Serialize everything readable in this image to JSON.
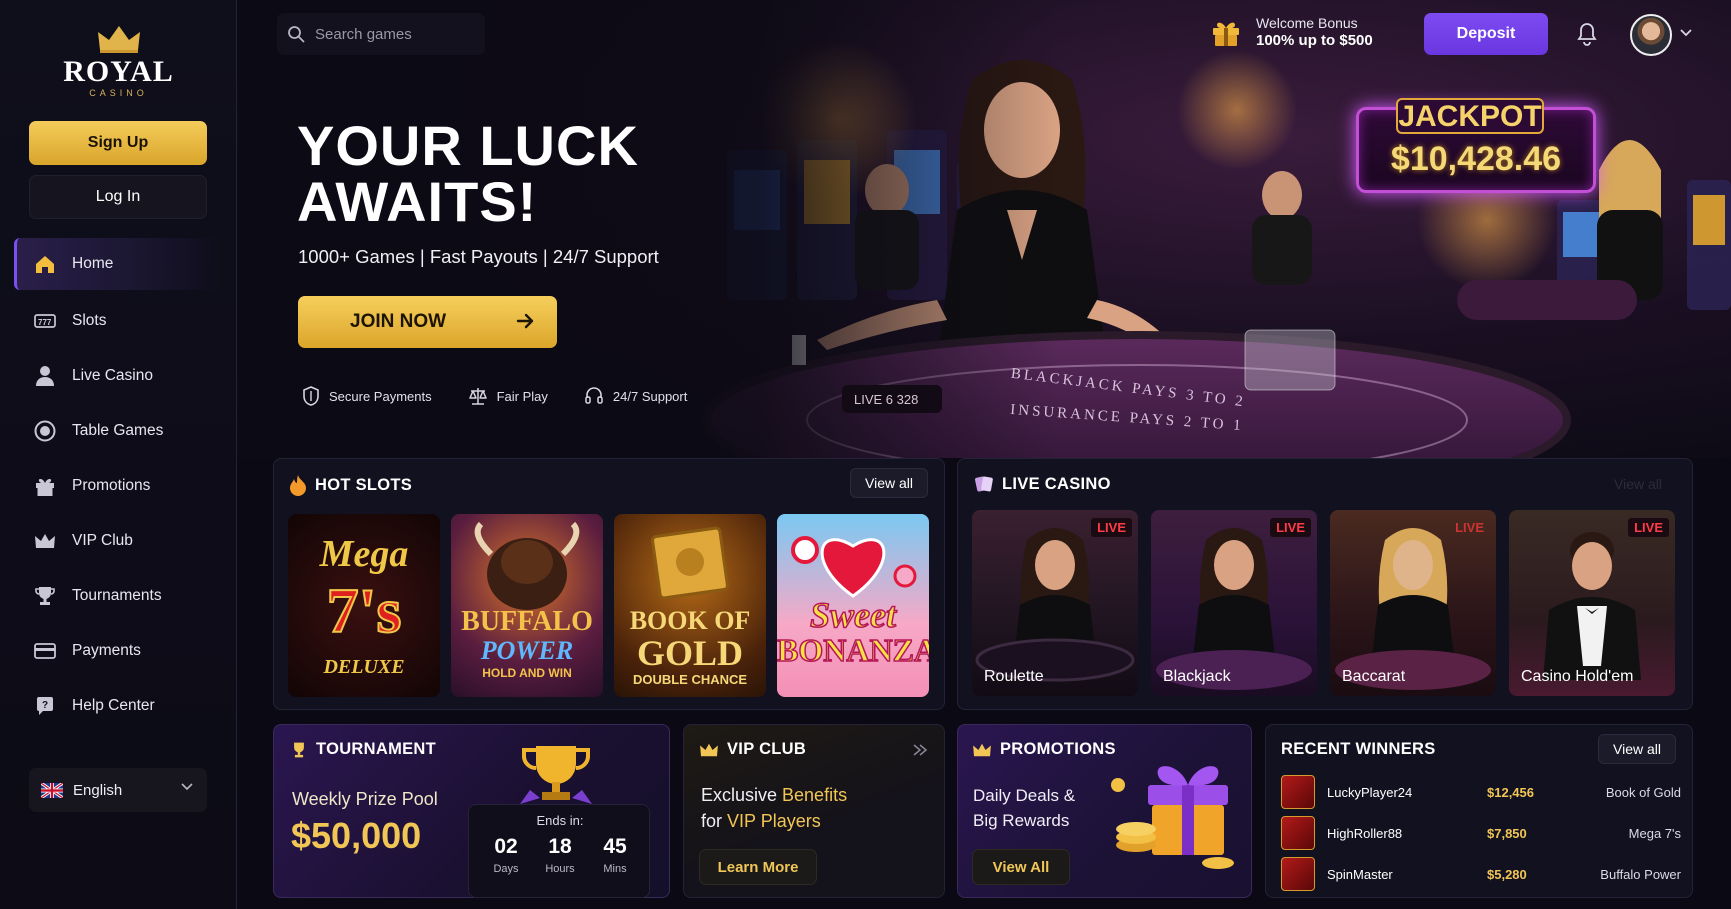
{
  "brand": {
    "name": "ROYAL",
    "tagline": "CASINO"
  },
  "auth": {
    "signup": "Sign Up",
    "login": "Log In"
  },
  "nav": [
    {
      "label": "Home",
      "icon": "home-icon",
      "active": true
    },
    {
      "label": "Slots",
      "icon": "slots-icon"
    },
    {
      "label": "Live Casino",
      "icon": "user-icon"
    },
    {
      "label": "Table Games",
      "icon": "chip-icon"
    },
    {
      "label": "Promotions",
      "icon": "gift-icon"
    },
    {
      "label": "VIP Club",
      "icon": "crown-icon"
    },
    {
      "label": "Tournaments",
      "icon": "trophy-icon"
    },
    {
      "label": "Payments",
      "icon": "card-icon"
    },
    {
      "label": "Help Center",
      "icon": "help-icon"
    }
  ],
  "language": {
    "value": "English",
    "flag": "uk-flag-icon"
  },
  "search": {
    "placeholder": "Search games"
  },
  "bonus": {
    "line1": "Welcome Bonus",
    "line2": "100% up to $500"
  },
  "header": {
    "deposit": "Deposit"
  },
  "hero": {
    "title": "YOUR LUCK AWAITS!",
    "subtitle": "1000+ Games | Fast Payouts | 24/7 Support",
    "cta": "JOIN NOW",
    "features": [
      "Secure Payments",
      "Fair Play",
      "24/7 Support"
    ],
    "jackpot_label": "JACKPOT",
    "jackpot_amount": "$10,428.46",
    "table_line1": "BLACKJACK PAYS 3 TO 2",
    "table_line2": "INSURANCE PAYS 2 TO 1",
    "table_chip": "LIVE  6 328"
  },
  "hot_slots": {
    "title": "HOT SLOTS",
    "view_all": "View all",
    "games": [
      {
        "line1": "Mega",
        "line2": "7's",
        "line3": "DELUXE"
      },
      {
        "line1": "BUFFALO",
        "line2": "POWER",
        "line3": "HOLD AND WIN"
      },
      {
        "line1": "BOOK OF",
        "line2": "GOLD",
        "line3": "DOUBLE CHANCE"
      },
      {
        "line1": "Sweet",
        "line2": "BONANZA",
        "line3": ""
      }
    ]
  },
  "live_casino": {
    "title": "LIVE CASINO",
    "view_all": "View all",
    "badge": "LIVE",
    "games": [
      "Roulette",
      "Blackjack",
      "Baccarat",
      "Casino Hold'em"
    ]
  },
  "tournament": {
    "title": "TOURNAMENT",
    "pool_label": "Weekly Prize Pool",
    "pool_amount": "$50,000",
    "ends_label": "Ends in:",
    "days": "02",
    "days_label": "Days",
    "hours": "18",
    "hours_label": "Hours",
    "mins": "45",
    "mins_label": "Mins"
  },
  "vip": {
    "title": "VIP CLUB",
    "line1_a": "Exclusive ",
    "line1_b": "Benefits",
    "line2_a": "for ",
    "line2_b": "VIP Players",
    "cta": "Learn More"
  },
  "promotions": {
    "title": "PROMOTIONS",
    "line1": "Daily Deals &",
    "line2": "Big Rewards",
    "cta": "View All"
  },
  "winners": {
    "title": "RECENT WINNERS",
    "view_all": "View all",
    "rows": [
      {
        "name": "LuckyPlayer24",
        "amount": "$12,456",
        "game": "Book of Gold"
      },
      {
        "name": "HighRoller88",
        "amount": "$7,850",
        "game": "Mega 7's"
      },
      {
        "name": "SpinMaster",
        "amount": "$5,280",
        "game": "Buffalo Power"
      }
    ]
  },
  "colors": {
    "accent": "#7b4ff0",
    "gold": "#f2c655",
    "live_red": "#ff3b48"
  }
}
